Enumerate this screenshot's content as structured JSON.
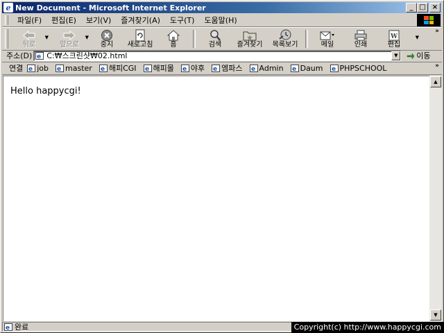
{
  "window": {
    "title": "New Document - Microsoft Internet Explorer"
  },
  "caption_buttons": {
    "minimize": "_",
    "maximize": "□",
    "close": "×"
  },
  "menu": [
    "파일(F)",
    "편집(E)",
    "보기(V)",
    "즐겨찾기(A)",
    "도구(T)",
    "도움말(H)"
  ],
  "toolbar": {
    "back": "뒤로",
    "forward": "앞으로",
    "stop": "중지",
    "refresh": "새로고침",
    "home": "홈",
    "search": "검색",
    "favorites": "즐겨찾기",
    "history": "목록보기",
    "mail": "메일",
    "print": "인쇄",
    "edit": "편집"
  },
  "address": {
    "label": "주소(D)",
    "value": "C:₩스크린샷₩02.html",
    "go": "이동"
  },
  "links": {
    "label": "연결",
    "items": [
      "job",
      "master",
      "해피CGI",
      "해피몰",
      "야후",
      "엠파스",
      "Admin",
      "Daum",
      "PHPSCHOOL"
    ]
  },
  "page": {
    "text": "Hello happycgi!"
  },
  "status": {
    "text": "완료"
  },
  "overlay": {
    "copyright": "Copyright(c) http://www.happycgi.com"
  },
  "colors": {
    "title_start": "#0a246a",
    "title_end": "#a6caf0",
    "chrome": "#d4d0c8"
  }
}
